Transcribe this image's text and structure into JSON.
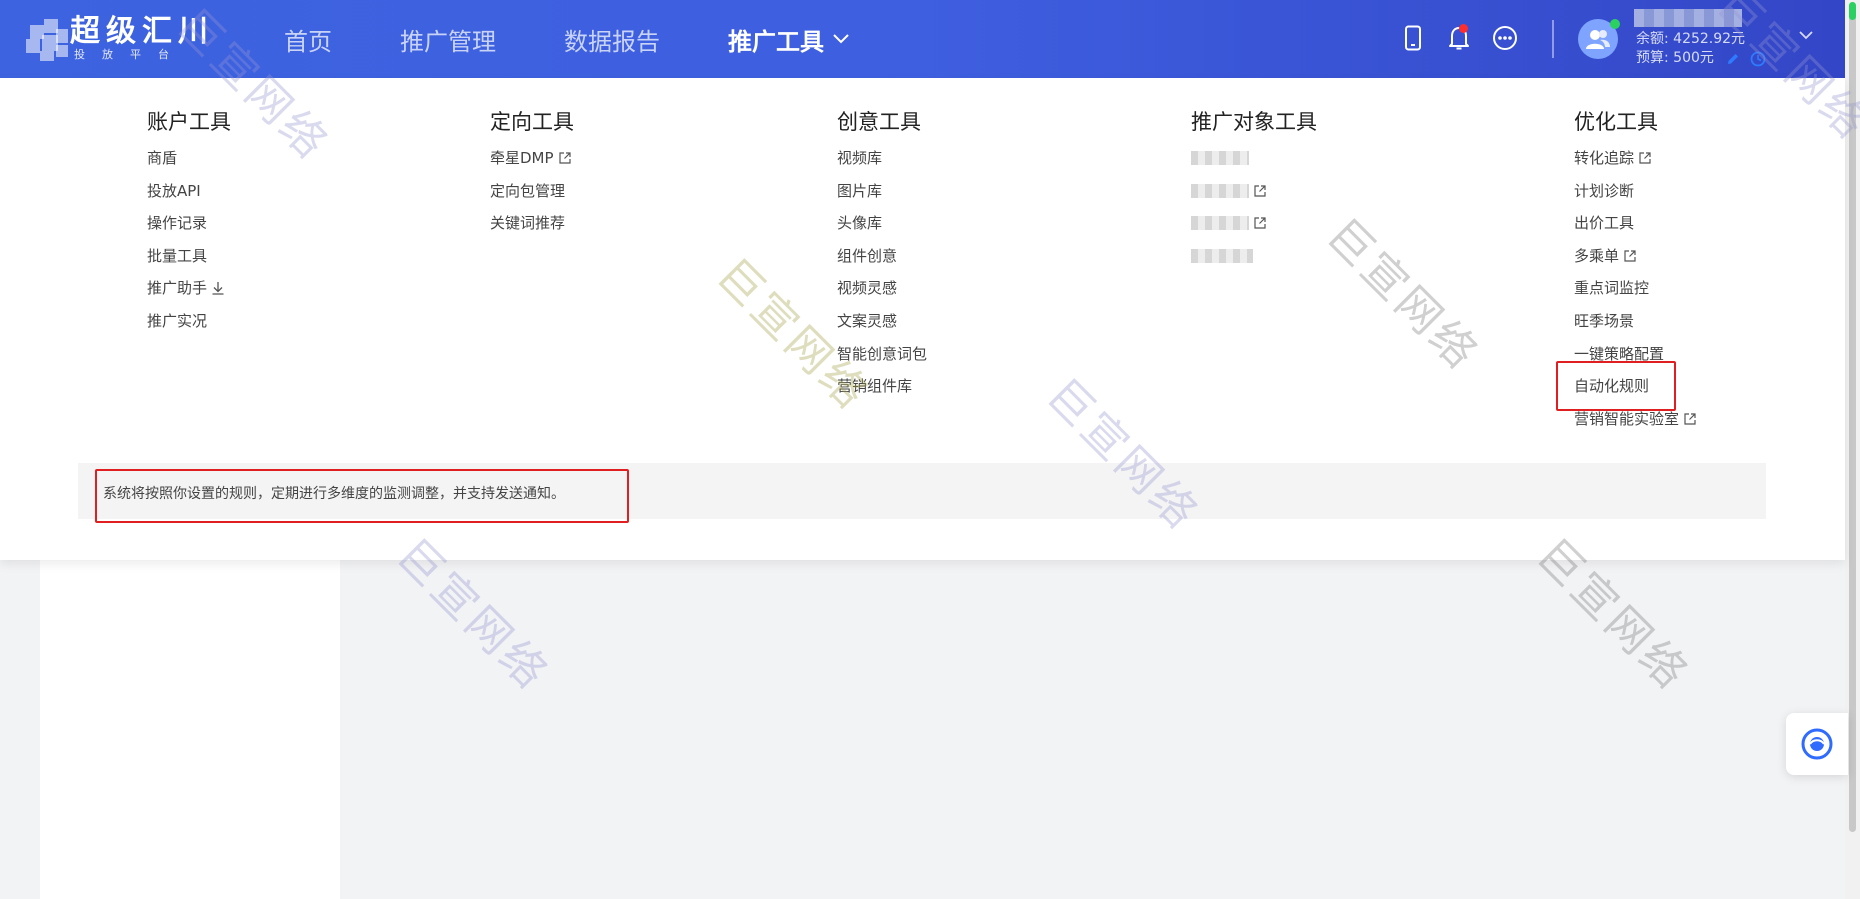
{
  "header": {
    "logo": {
      "title": "超级汇川",
      "subtitle": "投放平台"
    },
    "nav": [
      {
        "label": "首页"
      },
      {
        "label": "推广管理"
      },
      {
        "label": "数据报告"
      },
      {
        "label": "推广工具",
        "active": true
      }
    ],
    "icons": [
      "mobile-icon",
      "bell-icon",
      "more-icon"
    ],
    "account": {
      "balance": "余额: 4252.92元",
      "budget": "预算: 500元"
    },
    "colors": {
      "header_start": "#3d63e0",
      "header_end": "#3346c7",
      "notify_dot": "#ff2e2e",
      "online_dot": "#2bd160"
    }
  },
  "menu": {
    "columns": [
      {
        "title": "账户工具",
        "items": [
          {
            "label": "商盾"
          },
          {
            "label": "投放API"
          },
          {
            "label": "操作记录"
          },
          {
            "label": "批量工具"
          },
          {
            "label": "推广助手",
            "icon": "download-icon"
          },
          {
            "label": "推广实况"
          }
        ]
      },
      {
        "title": "定向工具",
        "items": [
          {
            "label": "牵星DMP",
            "icon": "external-link-icon"
          },
          {
            "label": "定向包管理"
          },
          {
            "label": "关键词推荐"
          }
        ]
      },
      {
        "title": "创意工具",
        "items": [
          {
            "label": "视频库"
          },
          {
            "label": "图片库"
          },
          {
            "label": "头像库"
          },
          {
            "label": "组件创意"
          },
          {
            "label": "视频灵感"
          },
          {
            "label": "文案灵感"
          },
          {
            "label": "智能创意词包"
          },
          {
            "label": "营销组件库"
          }
        ]
      },
      {
        "title": "推广对象工具",
        "items": [
          {
            "label": "",
            "blurred": true
          },
          {
            "label": "",
            "blurred": true,
            "icon": "external-link-icon"
          },
          {
            "label": "",
            "blurred": true,
            "icon": "external-link-icon"
          },
          {
            "label": "",
            "blurred": true
          }
        ]
      },
      {
        "title": "优化工具",
        "items": [
          {
            "label": "转化追踪",
            "icon": "external-link-icon"
          },
          {
            "label": "计划诊断"
          },
          {
            "label": "出价工具"
          },
          {
            "label": "多乘单",
            "icon": "external-link-icon"
          },
          {
            "label": "重点词监控"
          },
          {
            "label": "旺季场景"
          },
          {
            "label": "一键策略配置"
          },
          {
            "label": "自动化规则",
            "highlighted": true
          },
          {
            "label": "营销智能实验室",
            "icon": "external-link-icon"
          }
        ]
      }
    ],
    "hint": "系统将按照你设置的规则，定期进行多维度的监测调整，并支持发送通知。",
    "highlight_color": "#e02020"
  },
  "watermark": {
    "text": "巨宣网络"
  }
}
